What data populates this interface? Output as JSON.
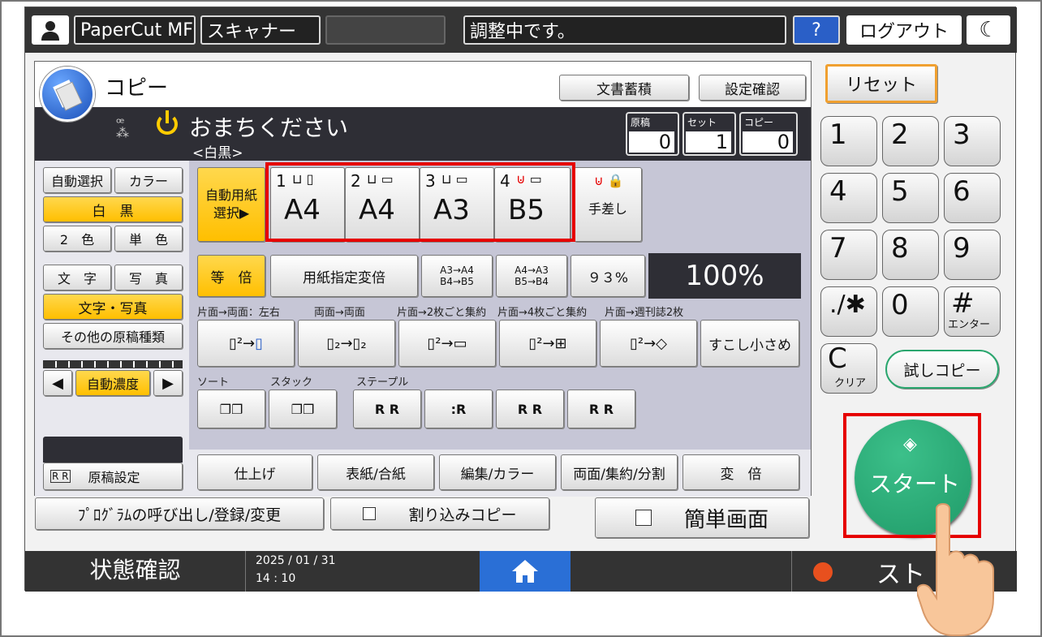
{
  "topbar": {
    "app": "PaperCut MF",
    "scanner": "スキャナー",
    "status": "調整中です。",
    "help": "?",
    "logout": "ログアウト",
    "moon": "☾"
  },
  "header": {
    "title": "コピー",
    "doc_store": "文書蓄積",
    "settings_check": "設定確認",
    "wait": "おまちください",
    "mode": "<白黒>",
    "originals_label": "原稿",
    "originals": "0",
    "sets_label": "セット",
    "sets": "1",
    "copies_label": "コピー",
    "copies": "0"
  },
  "left": {
    "auto_select": "自動選択",
    "color": "カラー",
    "bw": "白　黒",
    "two_color": "2　色",
    "single_color": "単　色",
    "text": "文　字",
    "photo": "写　真",
    "text_photo": "文字・写真",
    "other_types": "その他の原稿種類",
    "auto_density": "自動濃度",
    "original_settings": "原稿設定"
  },
  "paper": {
    "auto": "自動用紙\n選択▶",
    "trays": [
      {
        "num": "1",
        "size": "A4"
      },
      {
        "num": "2",
        "size": "A4"
      },
      {
        "num": "3",
        "size": "A3"
      },
      {
        "num": "4",
        "size": "B5"
      }
    ],
    "bypass": "手差し"
  },
  "ratio": {
    "same": "等　倍",
    "specified": "用紙指定変倍",
    "a3a4": "A3→A4\nB4→B5",
    "a4a3": "A4→A3\nB5→B4",
    "p93": "９３%",
    "current": "100%"
  },
  "duplex": {
    "l1": "片面→両面：左右",
    "l2": "両面→両面",
    "l3": "片面→2枚ごと集約",
    "l4": "片面→4枚ごと集約",
    "l5": "片面→週刊誌2枚",
    "smaller": "すこし小さめ"
  },
  "finish": {
    "sort": "ソート",
    "stack": "スタック",
    "staple": "ステープル"
  },
  "tabs": [
    "仕上げ",
    "表紙/合紙",
    "編集/カラー",
    "両面/集約/分割",
    "変　倍"
  ],
  "bottom_buttons": {
    "program": "ﾌﾟﾛｸﾞﾗﾑの呼び出し/登録/変更",
    "interrupt": "割り込みコピー",
    "simple": "簡単画面"
  },
  "keypad": {
    "reset": "リセット",
    "keys": [
      "1",
      "2",
      "3",
      "4",
      "5",
      "6",
      "7",
      "8",
      "9",
      ".∕✱",
      "0",
      "#"
    ],
    "enter": "エンター",
    "clear": "C",
    "clear_label": "クリア",
    "sample": "試しコピー",
    "start": "スタート"
  },
  "statusbar": {
    "status_check": "状態確認",
    "date": "2025 / 01 / 31",
    "time": "14 : 10",
    "stop": "スト"
  }
}
